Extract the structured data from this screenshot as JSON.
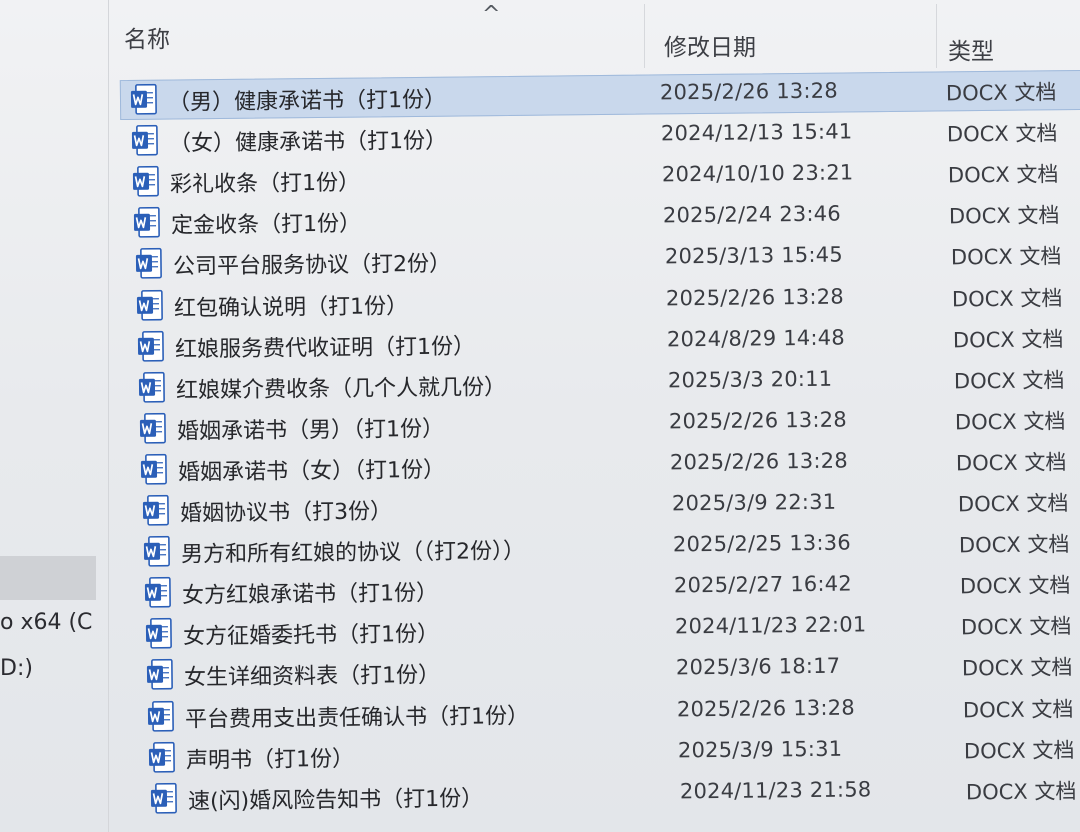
{
  "header": {
    "name": "名称",
    "date_modified": "修改日期",
    "type": "类型",
    "sort_glyph": "^"
  },
  "nav": {
    "item1": "o x64 (C",
    "item2": "D:)"
  },
  "colors": {
    "selection_bg": "#c9d8ec",
    "word_icon_blue": "#2b5fb8"
  },
  "files": [
    {
      "name": "（男）健康承诺书（打1份）",
      "date": "2025/2/26 13:28",
      "type": "DOCX 文档",
      "selected": true
    },
    {
      "name": "（女）健康承诺书（打1份）",
      "date": "2024/12/13 15:41",
      "type": "DOCX 文档"
    },
    {
      "name": "彩礼收条（打1份）",
      "date": "2024/10/10 23:21",
      "type": "DOCX 文档"
    },
    {
      "name": "定金收条（打1份）",
      "date": "2025/2/24 23:46",
      "type": "DOCX 文档"
    },
    {
      "name": "公司平台服务协议（打2份）",
      "date": "2025/3/13 15:45",
      "type": "DOCX 文档"
    },
    {
      "name": "红包确认说明（打1份）",
      "date": "2025/2/26 13:28",
      "type": "DOCX 文档"
    },
    {
      "name": "红娘服务费代收证明（打1份）",
      "date": "2024/8/29 14:48",
      "type": "DOCX 文档"
    },
    {
      "name": "红娘媒介费收条（几个人就几份）",
      "date": "2025/3/3 20:11",
      "type": "DOCX 文档"
    },
    {
      "name": "婚姻承诺书（男）（打1份）",
      "date": "2025/2/26 13:28",
      "type": "DOCX 文档"
    },
    {
      "name": "婚姻承诺书（女）（打1份）",
      "date": "2025/2/26 13:28",
      "type": "DOCX 文档"
    },
    {
      "name": "婚姻协议书（打3份）",
      "date": "2025/3/9 22:31",
      "type": "DOCX 文档"
    },
    {
      "name": "男方和所有红娘的协议（（打2份））",
      "date": "2025/2/25 13:36",
      "type": "DOCX 文档"
    },
    {
      "name": "女方红娘承诺书（打1份）",
      "date": "2025/2/27 16:42",
      "type": "DOCX 文档"
    },
    {
      "name": "女方征婚委托书（打1份）",
      "date": "2024/11/23 22:01",
      "type": "DOCX 文档"
    },
    {
      "name": "女生详细资料表（打1份）",
      "date": "2025/3/6 18:17",
      "type": "DOCX 文档"
    },
    {
      "name": "平台费用支出责任确认书（打1份）",
      "date": "2025/2/26 13:28",
      "type": "DOCX 文档"
    },
    {
      "name": "声明书（打1份）",
      "date": "2025/3/9 15:31",
      "type": "DOCX 文档"
    },
    {
      "name": "速(闪)婚风险告知书（打1份）",
      "date": "2024/11/23 21:58",
      "type": "DOCX 文档"
    }
  ]
}
